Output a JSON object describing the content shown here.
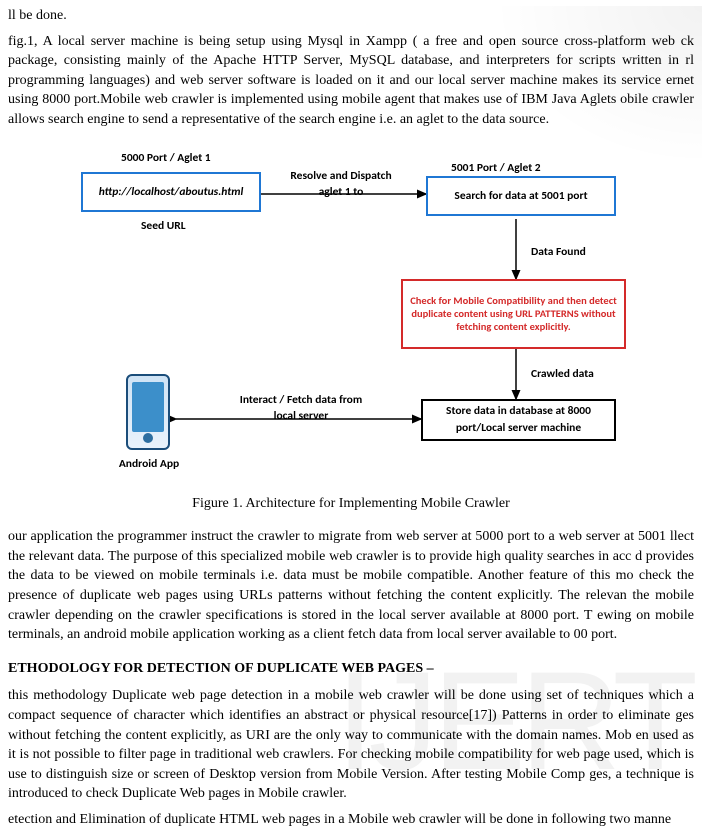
{
  "text": {
    "p1": "ll be done.",
    "p2": " fig.1, A local server machine is being setup using Mysql in Xampp ( a free and open source cross-platform web ck package, consisting mainly of the Apache HTTP Server, MySQL database, and interpreters for scripts written in rl programming languages) and web server software is loaded on it and our local server machine makes its service ernet using 8000 port.Mobile web crawler is implemented using mobile agent that makes use of IBM Java Aglets obile crawler allows search engine to send a representative of the search engine i.e. an aglet to the data source.",
    "caption": "Figure 1. Architecture for Implementing Mobile Crawler",
    "p3": "our application the programmer instruct the crawler to migrate from web server at 5000 port to a web server at 5001 llect the relevant data. The purpose of this specialized mobile web crawler is to provide high quality searches in acc d provides the data to be viewed on mobile terminals i.e. data must be mobile compatible. Another feature of this mo check the presence of duplicate web pages using URLs patterns without fetching the content explicitly. The relevan  the mobile crawler depending on the crawler specifications is stored in the local server available at 8000 port. T ewing on mobile terminals, an android mobile application working as a client fetch data from local server available to 00 port.",
    "h1": "ETHODOLOGY FOR DETECTION OF DUPLICATE WEB PAGES –",
    "p4": "this methodology Duplicate web page detection in a mobile web crawler will be done using set of techniques which a compact sequence of character which identifies an abstract or physical resource[17]) Patterns in order to eliminate ges without fetching the content explicitly, as URI are the only way to communicate with the domain names. Mob en used as it is not possible to filter page in traditional web crawlers. For checking mobile compatibility for web page used, which is use to distinguish size or screen of Desktop version from Mobile Version. After testing Mobile Comp ges, a technique is introduced to check Duplicate Web pages in Mobile crawler.",
    "p5": "etection and Elimination of duplicate HTML web pages in a Mobile web crawler will be done in following two manne"
  },
  "diagram": {
    "port1": "5000 Port / Aglet 1",
    "port2": "5001 Port / Aglet 2",
    "seedBox": "http://localhost/aboutus.html",
    "seedLabel": "Seed URL",
    "dispatchLabel": "Resolve and Dispatch\naglet 1 to",
    "searchBox": "Search for data at 5001 port",
    "dataFound": "Data Found",
    "checkBox": "Check for Mobile Compatibility and then detect duplicate content using URL PATTERNS without fetching content explicitly.",
    "crawled": "Crawled data",
    "storeBox": "Store data in database at 8000 port/Local server machine",
    "fetchLabel": "Interact / Fetch data from\nlocal server",
    "androidLabel": "Android App"
  }
}
